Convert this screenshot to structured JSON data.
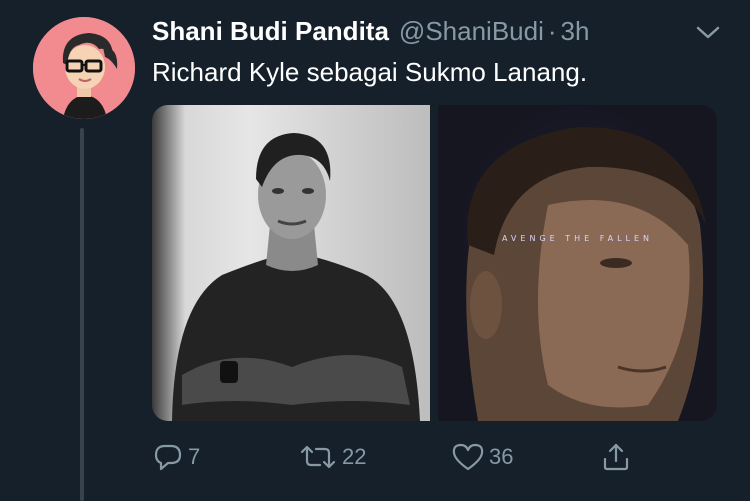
{
  "tweet": {
    "display_name": "Shani Budi Pandita",
    "handle": "@ShaniBudi",
    "separator": "·",
    "timestamp": "3h",
    "text": "Richard Kyle sebagai Sukmo Lanang.",
    "media": {
      "right_image_text": "AVENGE THE FALLEN"
    }
  },
  "actions": {
    "reply_count": "7",
    "retweet_count": "22",
    "like_count": "36"
  },
  "colors": {
    "background": "#15202b",
    "secondary_text": "#8899a6",
    "avatar_bg": "#f28b8f"
  }
}
